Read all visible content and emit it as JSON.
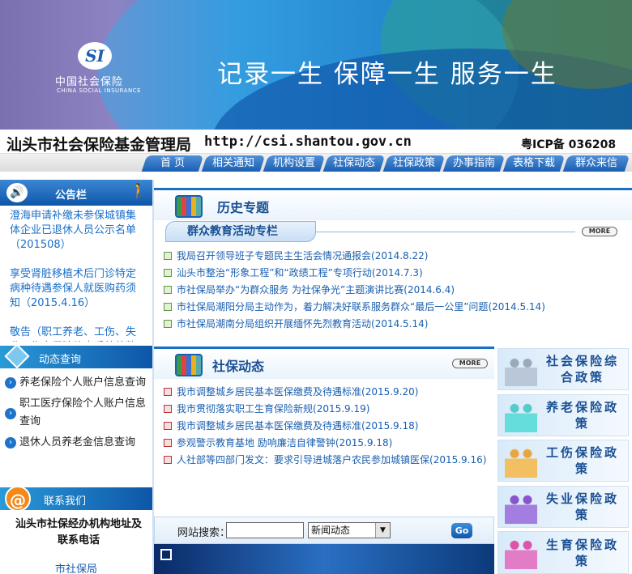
{
  "banner": {
    "logo_text": "SI",
    "logo_cn": "中国社会保险",
    "logo_en": "CHINA SOCIAL INSURANCE",
    "slogan": "记录一生  保障一生  服务一生"
  },
  "header": {
    "site_name": "汕头市社会保险基金管理局",
    "url": "http://csi.shantou.gov.cn",
    "icp": "粤ICP备 036208"
  },
  "nav": {
    "items": [
      "首  页",
      "相关通知",
      "机构设置",
      "社保动态",
      "社保政策",
      "办事指南",
      "表格下载",
      "群众来信"
    ]
  },
  "sidebar": {
    "notice_title": "公告栏",
    "notices": [
      "澄海申请补缴未参保城镇集体企业已退休人员公示名单（201508）",
      "享受肾脏移植术后门诊特定病种待遇参保人就医购药须知（2015.4.16）",
      "敬告（职工养老、工伤、失业、生育保险信息系统将整体"
    ],
    "query_title": "动态查询",
    "queries": [
      "养老保险个人账户信息查询",
      "职工医疗保险个人账户信息查询",
      "退休人员养老金信息查询"
    ],
    "contact_title": "联系我们",
    "contact_heading": "汕头市社保经办机构地址及联系电话",
    "contact_first": "市社保局"
  },
  "history": {
    "title": "历史专题",
    "subtab": "群众教育活动专栏",
    "more": "MORE",
    "items": [
      {
        "text": "我局召开领导班子专题民主生活会情况通报会",
        "date": "(2014.8.22)"
      },
      {
        "text": "汕头市整治“形象工程”和“政绩工程”专项行动",
        "date": "(2014.7.3)"
      },
      {
        "text": "市社保局举办“为群众服务 为社保争光”主题演讲比赛",
        "date": "(2014.6.4)"
      },
      {
        "text": "市社保局潮阳分局主动作为，着力解决好联系服务群众“最后一公里”问题",
        "date": "(2014.5.14)"
      },
      {
        "text": "市社保局潮南分局组织开展缅怀先烈教育活动",
        "date": "(2014.5.14)"
      }
    ]
  },
  "dynamics": {
    "title": "社保动态",
    "more": "MORE",
    "items": [
      {
        "text": "我市调整城乡居民基本医保缴费及待遇标准",
        "date": "(2015.9.20)"
      },
      {
        "text": "我市贯彻落实职工生育保险新规",
        "date": "(2015.9.19)"
      },
      {
        "text": "我市调整城乡居民基本医保缴费及待遇标准",
        "date": "(2015.9.18)"
      },
      {
        "text": "参观警示教育基地 励响廉洁自律警钟",
        "date": "(2015.9.18)"
      },
      {
        "text": "人社部等四部门发文：要求引导进城落户农民参加城镇医保",
        "date": "(2015.9.16)"
      }
    ]
  },
  "search": {
    "label": "网站搜索：",
    "input_value": "",
    "selected": "新闻动态",
    "go": "Go"
  },
  "policies": [
    "社会保险综合政策",
    "养老保险政策",
    "工伤保险政策",
    "失业保险政策",
    "生育保险政策"
  ],
  "colors": {
    "brand": "#1a6fc9",
    "nav": "#1b5fb3"
  }
}
